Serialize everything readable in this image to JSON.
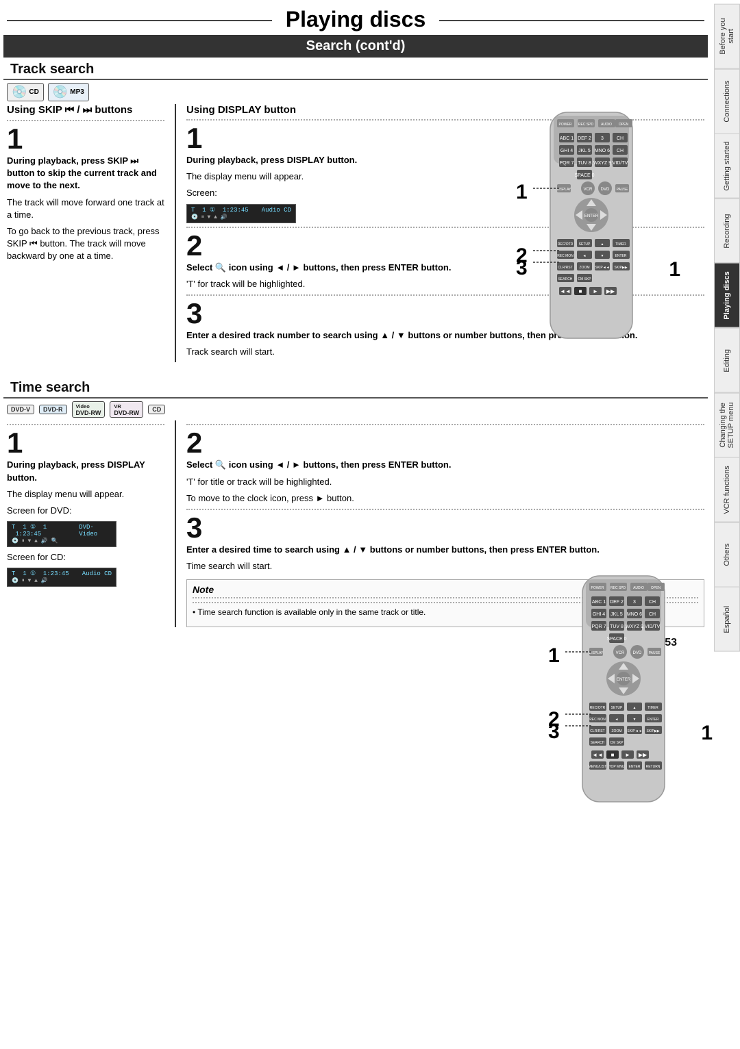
{
  "page": {
    "main_title": "Playing discs",
    "section_title": "Search (cont'd)",
    "page_number": "53"
  },
  "track_search": {
    "heading": "Track search",
    "icons": [
      "CD",
      "MP3"
    ],
    "skip_section": {
      "heading": "Using SKIP ◄◄ / ►► buttons",
      "step1": "1",
      "step1_bold": "During playback, press SKIP ►► button to skip the current track and move to the next.",
      "step1_text1": "The track will move forward one track at a time.",
      "step1_text2": "To go back to the previous track, press SKIP ◄◄ button. The track will move backward by one at a time."
    },
    "display_section": {
      "heading": "Using DISPLAY button",
      "step1": "1",
      "step1_bold": "During playback, press DISPLAY button.",
      "step1_text1": "The display menu will appear.",
      "step1_text2": "Screen:",
      "screen1_track": "T  1 ①  1:23:45",
      "screen1_label": "Audio CD",
      "step2": "2",
      "step2_bold": "Select  icon using ◄ / ► buttons, then press ENTER button.",
      "step2_text": "'T' for track will be highlighted.",
      "step3": "3",
      "step3_bold": "Enter a desired track number to search using ▲ / ▼ buttons or number buttons, then press ENTER button.",
      "step3_text": "Track search will start."
    }
  },
  "time_search": {
    "heading": "Time search",
    "icons": [
      "DVD-V",
      "DVD-R",
      "DVD-RW (Video)",
      "DVD-RW (VR)",
      "CD"
    ],
    "step1": "1",
    "step1_bold": "During playback, press DISPLAY button.",
    "step1_text1": "The display menu will appear.",
    "step1_text2": "Screen for DVD:",
    "screen_dvd": "T  1 ①  1  1:23:45",
    "screen_dvd_label": "DVD-Video",
    "step1_text3": "Screen for CD:",
    "screen_cd": "T  1 ①  1:23:45",
    "screen_cd_label": "Audio CD",
    "step2": "2",
    "step2_bold": "Select  icon using ◄ / ► buttons, then press ENTER button.",
    "step2_text1": "'T' for title or track will be highlighted.",
    "step2_text2": "To move to the clock icon, press ► button.",
    "step3": "3",
    "step3_bold": "Enter a desired time to search using ▲ / ▼ buttons or number buttons, then press ENTER button.",
    "step3_text": "Time search will start.",
    "note_title": "Note",
    "note_text": "Time search function is available only in the same track or title."
  },
  "sidebar": {
    "tabs": [
      {
        "label": "Before you start",
        "active": false
      },
      {
        "label": "Connections",
        "active": false
      },
      {
        "label": "Getting started",
        "active": false
      },
      {
        "label": "Recording",
        "active": false
      },
      {
        "label": "Playing discs",
        "active": true
      },
      {
        "label": "Editing",
        "active": false
      },
      {
        "label": "Changing the SETUP menu",
        "active": false
      },
      {
        "label": "VCR functions",
        "active": false
      },
      {
        "label": "Others",
        "active": false
      },
      {
        "label": "Español",
        "active": false
      }
    ]
  }
}
